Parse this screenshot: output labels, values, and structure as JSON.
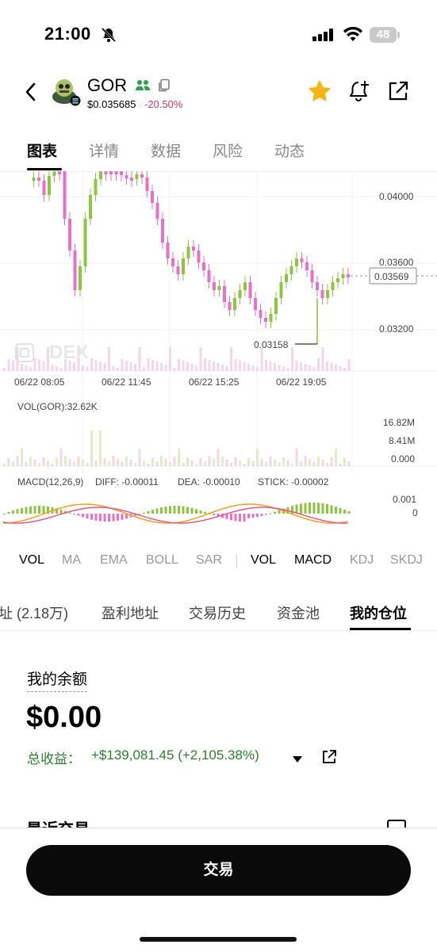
{
  "status_bar": {
    "time": "21:00",
    "battery": "48"
  },
  "header": {
    "token_name": "GOR",
    "price": "$0.035685",
    "change": "-20.50%",
    "colors": {
      "down": "#d6336c",
      "star": "#f5b516"
    }
  },
  "tabs": [
    {
      "label": "图表",
      "active": true
    },
    {
      "label": "详情"
    },
    {
      "label": "数据"
    },
    {
      "label": "风险"
    },
    {
      "label": "动态"
    }
  ],
  "chart": {
    "watermark": "DEX",
    "price_ticks": [
      "0.04000",
      "0.03600",
      "0.03200"
    ],
    "current_price": "0.03569",
    "low_marker": "0.03158",
    "time_ticks": [
      "06/22 08:05",
      "06/22 11:45",
      "06/22 15:25",
      "06/22 19:05"
    ],
    "vol_title": "VOL(GOR):32.62K",
    "vol_ticks": [
      "16.82M",
      "8.41M",
      "0.000"
    ],
    "macd_title": "MACD(12,26,9)",
    "macd_diff": "DIFF: -0.00011",
    "macd_dea": "DEA: -0.00010",
    "macd_stick": "STICK: -0.00002",
    "macd_ticks": [
      "0.001",
      "0"
    ],
    "colors": {
      "up": "#8cc63f",
      "down": "#e96fc7",
      "diff": "#f0a020",
      "dea": "#e05a8a",
      "stick": "#29b6d9"
    }
  },
  "chart_data": {
    "type": "candlestick",
    "x_labels": [
      "06/22 08:05",
      "06/22 11:45",
      "06/22 15:25",
      "06/22 19:05"
    ],
    "y_ticks": [
      0.04,
      0.036,
      0.032
    ],
    "current_price": 0.03569,
    "low": 0.03158
  },
  "indicators": [
    {
      "label": "VOL",
      "on": true
    },
    {
      "label": "MA"
    },
    {
      "label": "EMA"
    },
    {
      "label": "BOLL"
    },
    {
      "label": "SAR"
    },
    {
      "label": "VOL",
      "on": true
    },
    {
      "label": "MACD",
      "on": true
    },
    {
      "label": "KDJ"
    },
    {
      "label": "SKDJ"
    }
  ],
  "sub_tabs": [
    {
      "label": "址 (2.18万)"
    },
    {
      "label": "盈利地址"
    },
    {
      "label": "交易历史"
    },
    {
      "label": "资金池"
    },
    {
      "label": "我的仓位",
      "active": true
    }
  ],
  "balance": {
    "label": "我的余额",
    "value": "$0.00",
    "pnl_label": "总收益：",
    "pnl_value": "+$139,081.45 (+2,105.38%)"
  },
  "recent_label": "最近交易",
  "trade_button": "交易"
}
